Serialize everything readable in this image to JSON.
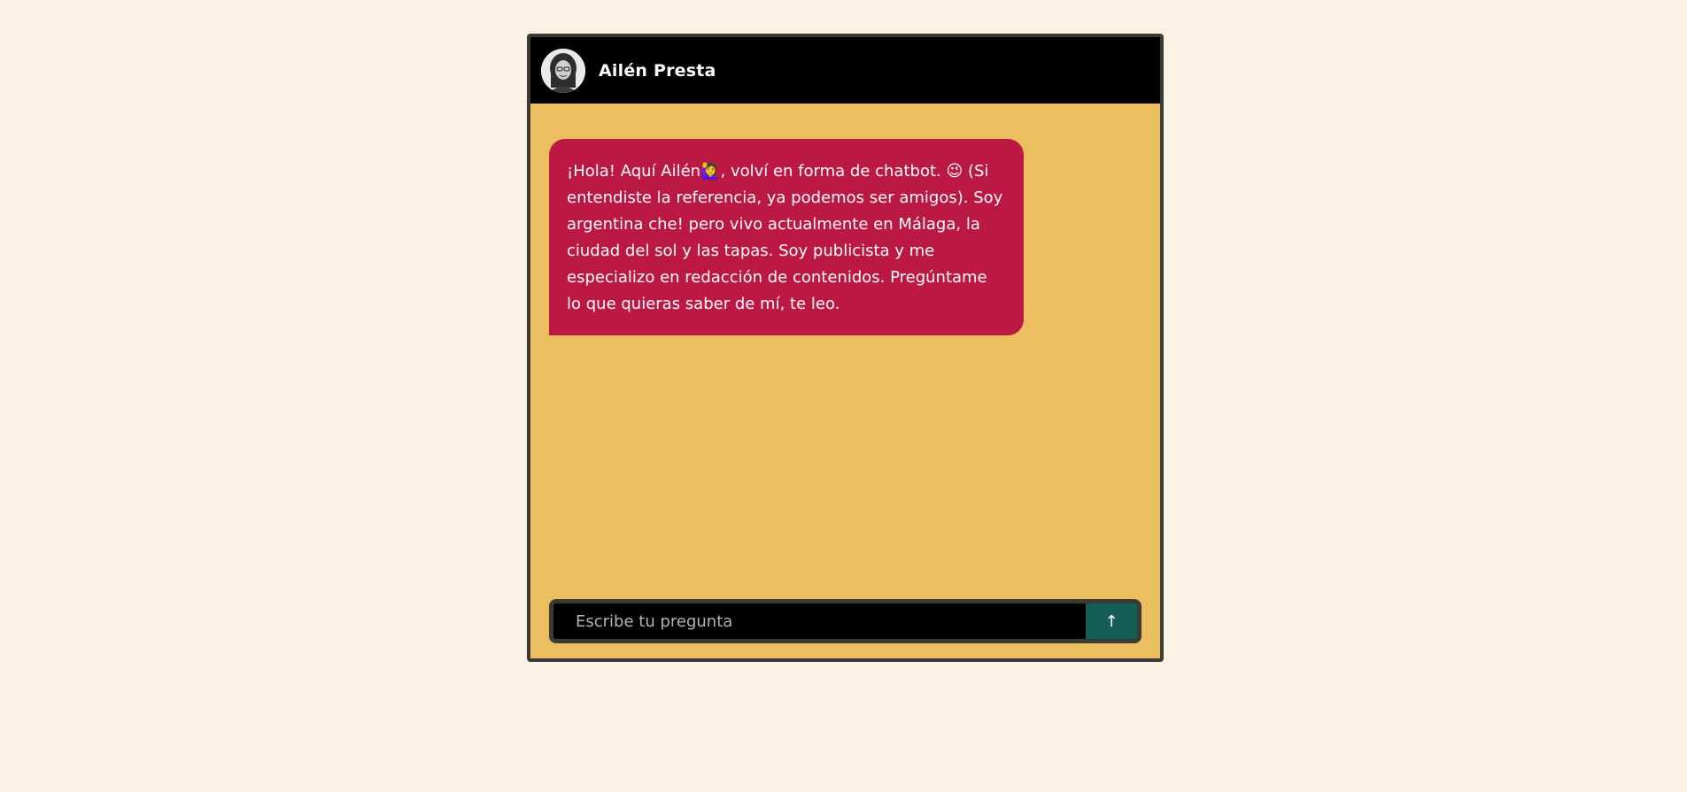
{
  "header": {
    "contact_name": "Ailén Presta",
    "avatar_icon": "avatar-photo"
  },
  "messages": [
    {
      "sender": "bot",
      "text": "¡Hola! Aquí Ailén🙋‍♀️, volví en forma de chatbot. 😉 (Si entendiste la referencia, ya podemos ser amigos). Soy argentina che! pero vivo actualmente en Málaga, la ciudad del sol y las tapas. Soy publicista y me especializo en redacción de contenidos. Pregúntame lo que quieras saber de mí, te leo."
    }
  ],
  "composer": {
    "placeholder": "Escribe tu pregunta",
    "value": "",
    "send_icon": "↑"
  },
  "colors": {
    "page_background": "#fcf2e3",
    "chat_background": "#ebbf60",
    "header_background": "#000000",
    "bubble_background": "#bb1944",
    "send_button": "#135f55",
    "border": "#3a3a36"
  }
}
